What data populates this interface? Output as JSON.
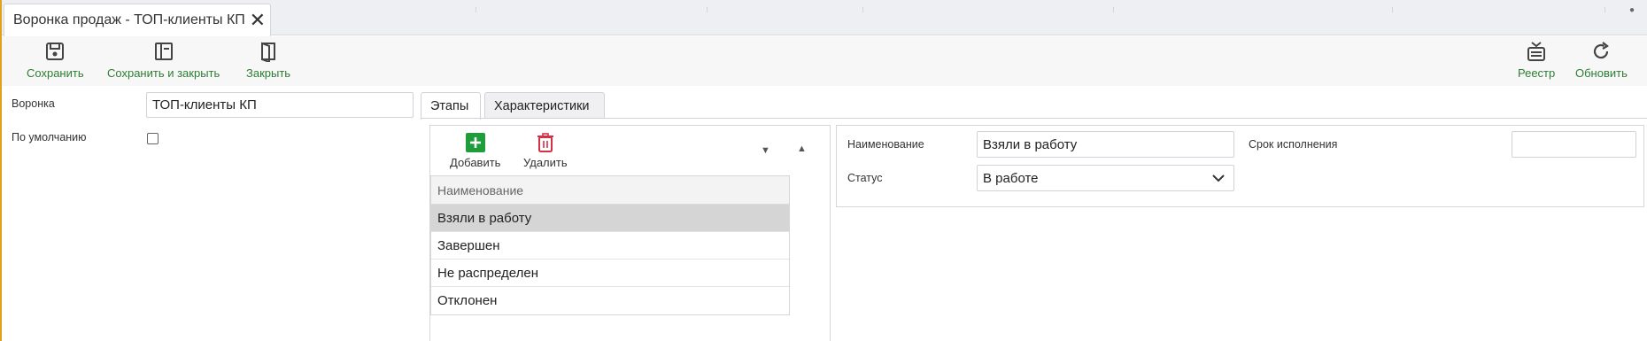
{
  "window": {
    "tab_title": "Воронка продаж - ТОП-клиенты КП",
    "close_glyph": "✕"
  },
  "toolbar": {
    "save_label": "Сохранить",
    "save_close_label": "Сохранить и закрыть",
    "close_label": "Закрыть",
    "registry_label": "Реестр",
    "refresh_label": "Обновить"
  },
  "form": {
    "funnel_label": "Воронка",
    "funnel_value": "ТОП-клиенты КП",
    "default_label": "По умолчанию",
    "default_checked": false
  },
  "tabs": [
    {
      "label": "Этапы",
      "active": true
    },
    {
      "label": "Характеристики",
      "active": false
    }
  ],
  "stages": {
    "add_label": "Добавить",
    "delete_label": "Удалить",
    "column_header": "Наименование",
    "rows": [
      "Взяли в работу",
      "Завершен",
      "Не распределен",
      "Отклонен"
    ],
    "selected_index": 0
  },
  "details": {
    "name_label": "Наименование",
    "name_value": "Взяли в работу",
    "status_label": "Статус",
    "status_value": "В работе",
    "deadline_label": "Срок исполнения",
    "deadline_value": ""
  },
  "colors": {
    "accent_green": "#2e7d32",
    "add_icon_bg": "#1f9d3a",
    "delete_icon": "#d32f45",
    "left_border": "#e0a21b"
  }
}
